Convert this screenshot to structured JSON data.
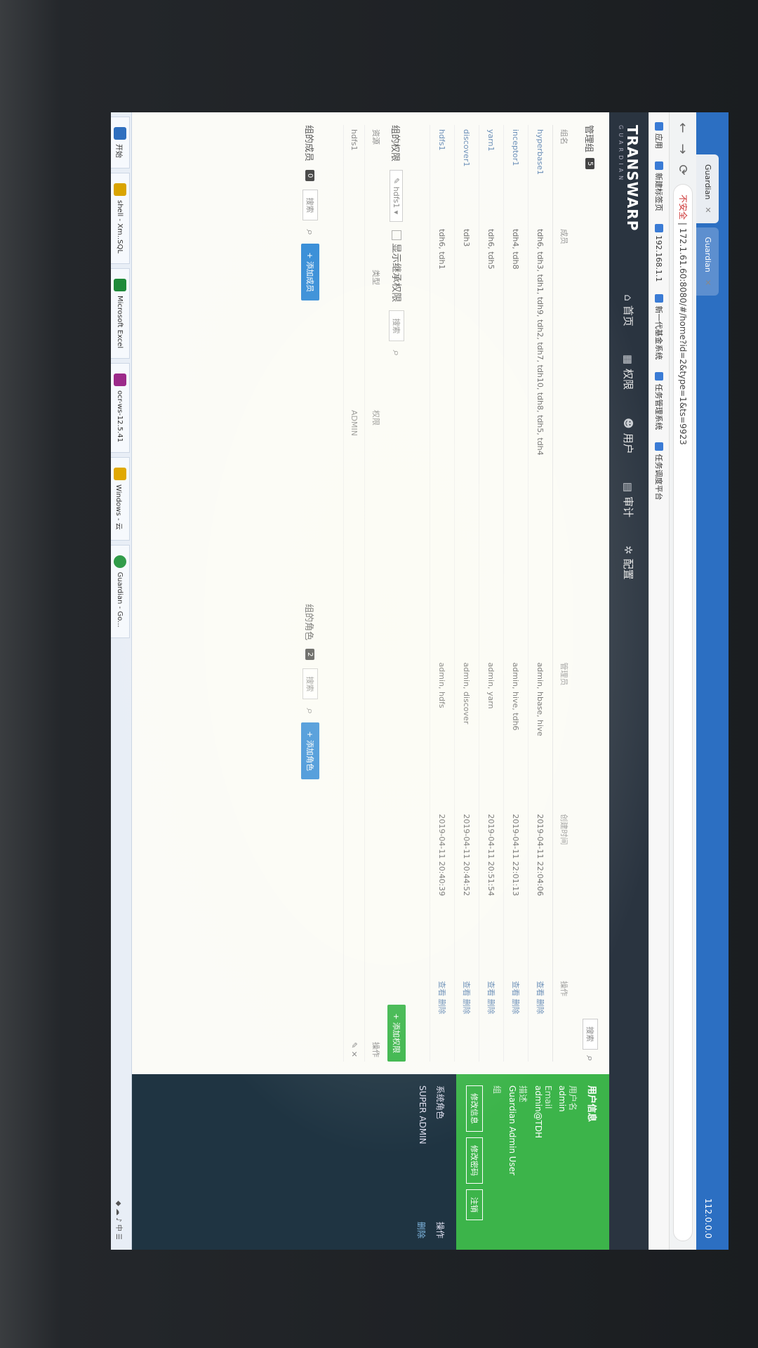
{
  "browser": {
    "tabs": [
      {
        "label": "Guardian"
      },
      {
        "label": "Guardian"
      }
    ],
    "tabstrip_right": "112.0.0.0",
    "url_prefix": "不安全",
    "url": "172.1.61.60:8080/#/home?id=2&type=1&ts=9923",
    "bookmarks": [
      "应用",
      "新建标签页",
      "192.168.1.1",
      "新一代基金系统",
      "任务管理系统",
      "任务调度平台"
    ]
  },
  "app": {
    "logo": "TRANSWARP",
    "logo_sub": "GUARDIAN",
    "nav": [
      {
        "icon": "⌂",
        "label": "首页"
      },
      {
        "icon": "▦",
        "label": "权限"
      },
      {
        "icon": "☻",
        "label": "用户"
      },
      {
        "icon": "▤",
        "label": "审计"
      },
      {
        "icon": "✲",
        "label": "配置"
      }
    ]
  },
  "groups": {
    "title": "管理组",
    "count": "5",
    "search_button": "搜索",
    "columns": [
      "组名",
      "成员",
      "管理员",
      "创建时间",
      "操作"
    ],
    "rows": [
      {
        "name": "hyperbase1",
        "members": "tdh6, tdh3, tdh1, tdh9, tdh2, tdh7, tdh10, tdh8, tdh5, tdh4",
        "admins": "admin, hbase, hive",
        "created": "2019-04-11 22:04:06",
        "actions": "查看  删除"
      },
      {
        "name": "inceptor1",
        "members": "tdh4, tdh8",
        "admins": "admin, hive, tdh6",
        "created": "2019-04-11 22:01:13",
        "actions": "查看  删除"
      },
      {
        "name": "yarn1",
        "members": "tdh6, tdh5",
        "admins": "admin, yarn",
        "created": "2019-04-11 20:51:54",
        "actions": "查看  删除"
      },
      {
        "name": "discover1",
        "members": "tdh3",
        "admins": "admin, discover",
        "created": "2019-04-11 20:44:52",
        "actions": "查看  删除"
      },
      {
        "name": "hdfs1",
        "members": "tdh6, tdh1",
        "admins": "admin, hdfs",
        "created": "2019-04-11 20:40:39",
        "actions": "查看  删除"
      }
    ]
  },
  "perms": {
    "title": "组的权限",
    "selected_group": "hdfs1",
    "show_inherited": "显示继承权限",
    "search_button": "搜索",
    "add_button": "+ 添加权限",
    "columns": [
      "资源",
      "类型",
      "权限",
      "",
      "操作"
    ],
    "rows": [
      {
        "resource": "hdfs1",
        "type": "",
        "perm": "ADMIN",
        "extra": "",
        "actions": "✎ ✕"
      }
    ]
  },
  "members": {
    "title": "组的成员",
    "count": "0",
    "search_button": "搜索",
    "add_button": "+ 添加成员"
  },
  "roles": {
    "title": "组的角色",
    "count": "2",
    "search_button": "搜索",
    "add_button": "+ 添加角色"
  },
  "sidebar": {
    "header": "用户信息",
    "fields": [
      {
        "label": "用户名",
        "value": "admin"
      },
      {
        "label": "Email",
        "value": "admin@TDH"
      },
      {
        "label": "描述",
        "value": "Guardian Admin User"
      },
      {
        "label": "组",
        "value": ""
      }
    ],
    "buttons": [
      "修改信息",
      "修改密码",
      "注销"
    ],
    "roles_title": "系统角色",
    "roles_action": "操作",
    "roles": [
      {
        "name": "SUPER ADMIN",
        "action": "删除"
      }
    ]
  },
  "taskbar": {
    "items": [
      {
        "label": "开始",
        "color": "#2f6fbf"
      },
      {
        "label": "shell - Xm..SQL",
        "color": "#d9a400"
      },
      {
        "label": "Microsoft Excel",
        "color": "#1f8a3a"
      },
      {
        "label": "ocr-ws-12.5.41",
        "color": "#9c2a8a"
      },
      {
        "label": "Windows - 云",
        "color": "#e0a800"
      },
      {
        "label": "Guardian - Go...",
        "color": "#2d9a46"
      }
    ],
    "tray": "◆ ☁ ♪ 中 ☰"
  }
}
